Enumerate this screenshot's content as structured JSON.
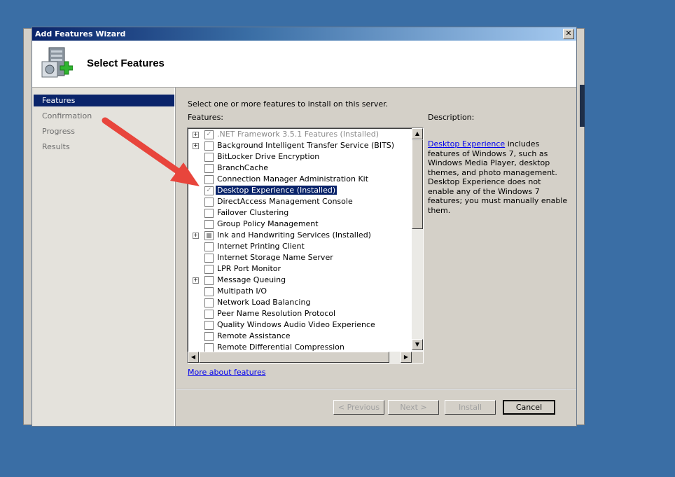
{
  "window": {
    "title": "Add Features Wizard",
    "close_glyph": "✕"
  },
  "header": {
    "heading": "Select Features"
  },
  "nav": {
    "items": [
      {
        "label": "Features",
        "active": true
      },
      {
        "label": "Confirmation",
        "active": false
      },
      {
        "label": "Progress",
        "active": false
      },
      {
        "label": "Results",
        "active": false
      }
    ]
  },
  "main": {
    "instruction": "Select one or more features to install on this server.",
    "features_label": "Features:",
    "description_label": "Description:",
    "description_link": "Desktop Experience",
    "description_text": "includes features of Windows 7, such as Windows Media Player, desktop themes, and photo management. Desktop Experience does not enable any of the Windows 7 features; you must manually enable them.",
    "more_link": "More about features"
  },
  "features": [
    {
      "label": ".NET Framework 3.5.1 Features  (Installed)",
      "expand": true,
      "state": "checked-disabled",
      "style": "grey"
    },
    {
      "label": "Background Intelligent Transfer Service (BITS)",
      "expand": true,
      "state": "unchecked",
      "style": "normal"
    },
    {
      "label": "BitLocker Drive Encryption",
      "expand": false,
      "state": "unchecked",
      "style": "normal"
    },
    {
      "label": "BranchCache",
      "expand": false,
      "state": "unchecked",
      "style": "normal"
    },
    {
      "label": "Connection Manager Administration Kit",
      "expand": false,
      "state": "unchecked",
      "style": "normal"
    },
    {
      "label": "Desktop Experience  (Installed)",
      "expand": false,
      "state": "checked-disabled",
      "style": "selected"
    },
    {
      "label": "DirectAccess Management Console",
      "expand": false,
      "state": "unchecked",
      "style": "normal"
    },
    {
      "label": "Failover Clustering",
      "expand": false,
      "state": "unchecked",
      "style": "normal"
    },
    {
      "label": "Group Policy Management",
      "expand": false,
      "state": "unchecked",
      "style": "normal"
    },
    {
      "label": "Ink and Handwriting Services  (Installed)",
      "expand": true,
      "state": "indeterminate",
      "style": "normal"
    },
    {
      "label": "Internet Printing Client",
      "expand": false,
      "state": "unchecked",
      "style": "normal"
    },
    {
      "label": "Internet Storage Name Server",
      "expand": false,
      "state": "unchecked",
      "style": "normal"
    },
    {
      "label": "LPR Port Monitor",
      "expand": false,
      "state": "unchecked",
      "style": "normal"
    },
    {
      "label": "Message Queuing",
      "expand": true,
      "state": "unchecked",
      "style": "normal"
    },
    {
      "label": "Multipath I/O",
      "expand": false,
      "state": "unchecked",
      "style": "normal"
    },
    {
      "label": "Network Load Balancing",
      "expand": false,
      "state": "unchecked",
      "style": "normal"
    },
    {
      "label": "Peer Name Resolution Protocol",
      "expand": false,
      "state": "unchecked",
      "style": "normal"
    },
    {
      "label": "Quality Windows Audio Video Experience",
      "expand": false,
      "state": "unchecked",
      "style": "normal"
    },
    {
      "label": "Remote Assistance",
      "expand": false,
      "state": "unchecked",
      "style": "normal"
    },
    {
      "label": "Remote Differential Compression",
      "expand": false,
      "state": "unchecked",
      "style": "normal"
    }
  ],
  "buttons": {
    "previous": "< Previous",
    "next": "Next >",
    "install": "Install",
    "cancel": "Cancel"
  },
  "colors": {
    "desktop": "#3a6ea5",
    "selection": "#0a246a",
    "annotation_arrow": "#e8453c"
  }
}
